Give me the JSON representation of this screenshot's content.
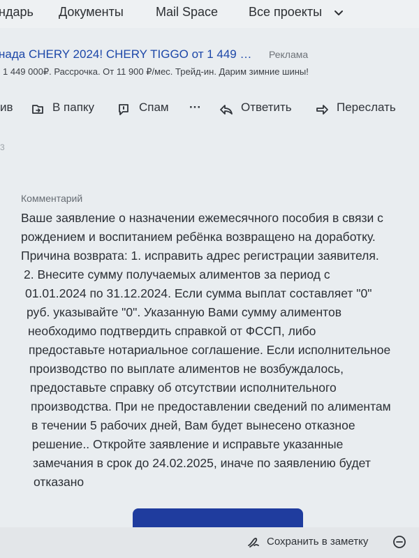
{
  "nav": {
    "items": [
      "ндарь",
      "Документы",
      "Mail Space",
      "Все проекты"
    ]
  },
  "ad": {
    "title": "нада CHERY 2024! CHERY TIGGO от 1 449 …",
    "badge": "Реклама",
    "text": "1 449 000₽. Рассрочка. От 11 900 ₽/мес. Трейд-ин. Дарим зимние шины!"
  },
  "toolbar": {
    "archive": "ив",
    "to_folder": "В папку",
    "spam": "Спам",
    "more": "···",
    "reply": "Ответить",
    "forward": "Переслать"
  },
  "stray_char": "3",
  "comment": {
    "label": "Комментарий",
    "lines": [
      "Ваше заявление о назначении ежемесячного пособия в связи с",
      "рождением и воспитанием ребёнка возвращено на доработку.",
      "Причина возврата: 1. исправить адрес регистрации заявителя.",
      "2. Внесите сумму получаемых алиментов за период с",
      "01.01.2024 по 31.12.2024. Если сумма выплат составляет \"0\"",
      "руб. указывайте \"0\". Указанную Вами сумму алиментов",
      "необходимо подтвердить справкой от ФССП, либо",
      "предоставьте нотариальное соглашение. Если исполнительное",
      "производство по выплате алиментов не возбуждалось,",
      "предоставьте справку об отсутствии исполнительного",
      "производства. При не предоставлении сведений по алиментам",
      "в течении 5 рабочих дней, Вам будет вынесено отказное",
      "решение.. Откройте заявление и исправьте указанные",
      "замечания в срок до 24.02.2025, иначе по заявлению будет",
      "отказано"
    ]
  },
  "footer": {
    "save_note": "Сохранить в заметку"
  },
  "colors": {
    "accent": "#1f3c9e",
    "link": "#1c47a8",
    "background": "#e9edf0"
  }
}
